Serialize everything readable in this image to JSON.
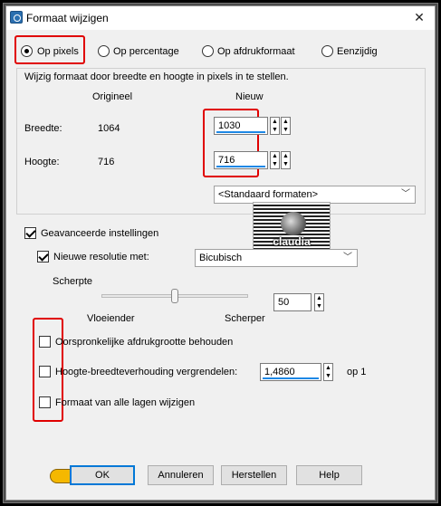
{
  "window": {
    "title": "Formaat wijzigen",
    "close_glyph": "✕"
  },
  "mode": {
    "options": [
      "Op pixels",
      "Op percentage",
      "Op afdrukformaat",
      "Eenzijdig"
    ],
    "selected": "Op pixels"
  },
  "size_group": {
    "description": "Wijzig formaat door breedte en hoogte in pixels in te stellen.",
    "col_original": "Origineel",
    "col_new": "Nieuw",
    "width_label": "Breedte:",
    "width_original": "1064",
    "width_new": "1030",
    "height_label": "Hoogte:",
    "height_original": "716",
    "height_new": "716",
    "presets": "<Standaard formaten>"
  },
  "advanced": {
    "label": "Geavanceerde instellingen",
    "checked": true,
    "resolution_label": "Nieuwe resolutie met:",
    "resolution_checked": true,
    "resolution_method": "Bicubisch",
    "sharpness_label": "Scherpte",
    "sharpness_value": "50",
    "sharpness_level": 0.5,
    "slider_left": "Vloeiender",
    "slider_right": "Scherper"
  },
  "options": {
    "keep_print_size": "Oorspronkelijke afdrukgrootte behouden",
    "lock_aspect": "Hoogte-breedteverhouding vergrendelen:",
    "aspect_value": "1,4860",
    "aspect_suffix": "op 1",
    "resize_layers": "Formaat van alle lagen wijzigen"
  },
  "buttons": {
    "ok": "OK",
    "cancel": "Annuleren",
    "reset": "Herstellen",
    "help": "Help"
  },
  "logo": {
    "text": "claudia"
  },
  "colors": {
    "highlight": "#e00000",
    "accent": "#0078d7",
    "field_underline": "#1e88e5"
  }
}
